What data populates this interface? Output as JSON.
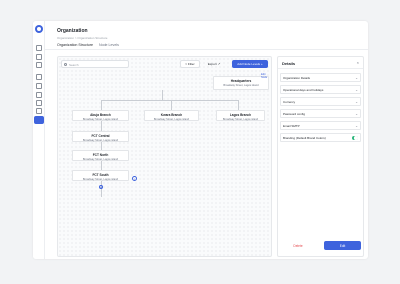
{
  "header": {
    "title": "Organization",
    "breadcrumb": "Organization  >  Organization Structure"
  },
  "tabs": [
    {
      "label": "Organization Structure",
      "active": true
    },
    {
      "label": "Node Levels",
      "active": false
    }
  ],
  "toolbar": {
    "search_placeholder": "Search",
    "filter_label": "Filter",
    "export_label": "Export",
    "add_node_label": "Add Node Levels"
  },
  "nodes": {
    "hq": {
      "title": "Headquarters",
      "subtitle": "Broadway Street, Lagos island"
    },
    "abuja": {
      "title": "Abuja Branch",
      "subtitle": "Broadway Street, Lagos island"
    },
    "kwara": {
      "title": "Kwara Branch",
      "subtitle": "Broadway Street, Lagos island"
    },
    "lagos": {
      "title": "Lagos Branch",
      "subtitle": "Broadway Street, Lagos island"
    },
    "fct_central": {
      "title": "FCT Central",
      "subtitle": "Broadway Street, Lagos island"
    },
    "fct_north": {
      "title": "FCT North",
      "subtitle": "Broadway Street, Lagos island"
    },
    "fct_south": {
      "title": "FCT South",
      "subtitle": "Broadway Street, Lagos island"
    }
  },
  "hq_edit_link": "Edit Node",
  "panel": {
    "title": "Details",
    "sections": [
      {
        "label": "Organization Details"
      },
      {
        "label": "Operational days and holidays"
      },
      {
        "label": "Currency"
      },
      {
        "label": "Password config"
      },
      {
        "label": "Email SMTP"
      },
      {
        "label": "Branding (Default Brand Colors)",
        "toggle_on": true
      }
    ],
    "delete_label": "Delete",
    "edit_label": "Edit"
  },
  "colors": {
    "accent": "#3e63dd",
    "danger": "#e5484d",
    "success": "#2eb67d"
  },
  "icons": {
    "search": "search-icon",
    "filter": "filter-icon",
    "export": "export-icon",
    "close": "close-icon",
    "chevron": "chevron-down-icon",
    "info": "info-icon",
    "add": "plus-icon"
  }
}
